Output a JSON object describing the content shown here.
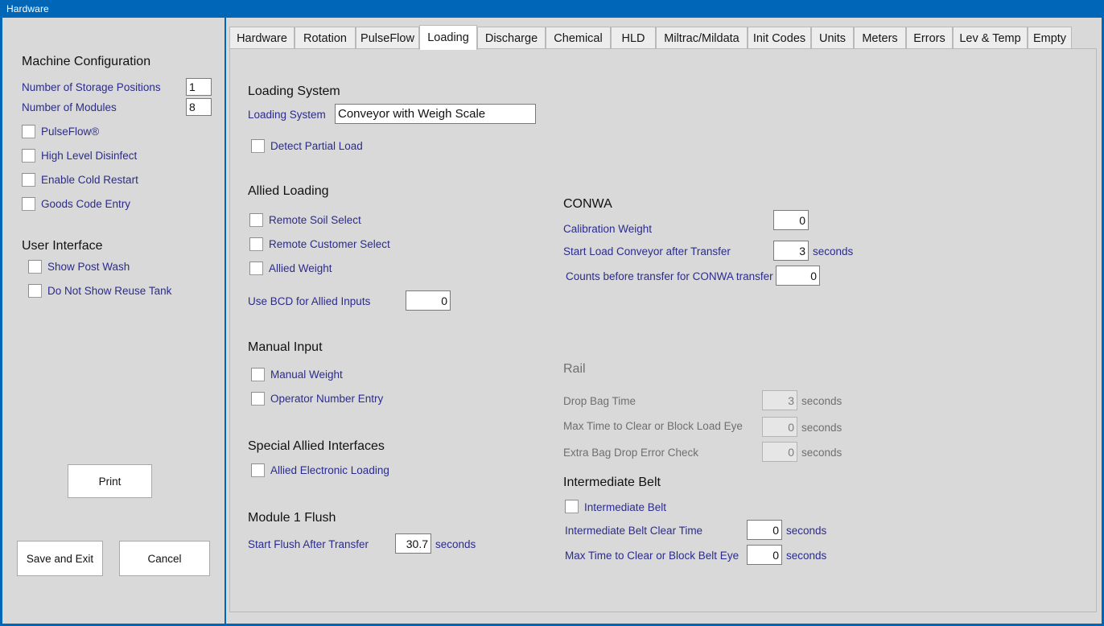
{
  "window": {
    "title": "Hardware"
  },
  "sidebar": {
    "machine_config": {
      "heading": "Machine Configuration",
      "fields": [
        {
          "label": "Number of Storage Positions",
          "value": "1"
        },
        {
          "label": "Number of Modules",
          "value": "8"
        }
      ],
      "checkboxes": [
        {
          "label": "PulseFlow®",
          "checked": false
        },
        {
          "label": "High Level Disinfect",
          "checked": false
        },
        {
          "label": "Enable Cold Restart",
          "checked": false
        },
        {
          "label": "Goods Code Entry",
          "checked": false
        }
      ]
    },
    "user_interface": {
      "heading": "User Interface",
      "checkboxes": [
        {
          "label": "Show Post Wash",
          "checked": false
        },
        {
          "label": "Do Not Show Reuse Tank",
          "checked": false
        }
      ]
    },
    "buttons": {
      "print": "Print",
      "save_and_exit": "Save and Exit",
      "cancel": "Cancel"
    }
  },
  "tabs": [
    {
      "label": "Hardware",
      "active": false
    },
    {
      "label": "Rotation",
      "active": false
    },
    {
      "label": "PulseFlow",
      "active": false
    },
    {
      "label": "Loading",
      "active": true
    },
    {
      "label": "Discharge",
      "active": false
    },
    {
      "label": "Chemical",
      "active": false
    },
    {
      "label": "HLD",
      "active": false
    },
    {
      "label": "Miltrac/Mildata",
      "active": false
    },
    {
      "label": "Init Codes",
      "active": false
    },
    {
      "label": "Units",
      "active": false
    },
    {
      "label": "Meters",
      "active": false
    },
    {
      "label": "Errors",
      "active": false
    },
    {
      "label": "Lev & Temp",
      "active": false
    },
    {
      "label": "Empty",
      "active": false
    }
  ],
  "loading_tab": {
    "loading_system": {
      "heading": "Loading System",
      "field_label": "Loading System",
      "field_value": "Conveyor with Weigh Scale",
      "checkbox": {
        "label": "Detect Partial Load",
        "checked": false
      }
    },
    "allied_loading": {
      "heading": "Allied Loading",
      "checkboxes": [
        {
          "label": "Remote Soil Select",
          "checked": false
        },
        {
          "label": "Remote Customer Select",
          "checked": false
        },
        {
          "label": "Allied Weight",
          "checked": false
        }
      ],
      "bcd": {
        "label": "Use BCD for Allied Inputs",
        "value": "0"
      }
    },
    "manual_input": {
      "heading": "Manual Input",
      "checkboxes": [
        {
          "label": "Manual Weight",
          "checked": false
        },
        {
          "label": "Operator Number Entry",
          "checked": false
        }
      ]
    },
    "special_allied": {
      "heading": "Special Allied Interfaces",
      "checkboxes": [
        {
          "label": "Allied Electronic Loading",
          "checked": false
        }
      ]
    },
    "module_flush": {
      "heading": "Module 1 Flush",
      "field": {
        "label": "Start Flush After Transfer",
        "value": "30.7",
        "unit": "seconds"
      }
    },
    "conwa": {
      "heading": "CONWA",
      "fields": [
        {
          "label": "Calibration Weight",
          "value": "0",
          "unit": ""
        },
        {
          "label": "Start Load Conveyor after Transfer",
          "value": "3",
          "unit": "seconds"
        },
        {
          "label": "Counts before transfer for CONWA transfer",
          "value": "0",
          "unit": ""
        }
      ]
    },
    "rail": {
      "heading": "Rail",
      "disabled": true,
      "fields": [
        {
          "label": "Drop Bag Time",
          "value": "3",
          "unit": "seconds"
        },
        {
          "label": "Max Time to Clear or Block Load Eye",
          "value": "0",
          "unit": "seconds"
        },
        {
          "label": "Extra Bag Drop Error Check",
          "value": "0",
          "unit": "seconds"
        }
      ]
    },
    "intermediate_belt": {
      "heading": "Intermediate Belt",
      "checkbox": {
        "label": "Intermediate Belt",
        "checked": false
      },
      "fields": [
        {
          "label": "Intermediate Belt Clear Time",
          "value": "0",
          "unit": "seconds"
        },
        {
          "label": "Max Time to Clear or Block Belt Eye",
          "value": "0",
          "unit": "seconds"
        }
      ]
    }
  }
}
